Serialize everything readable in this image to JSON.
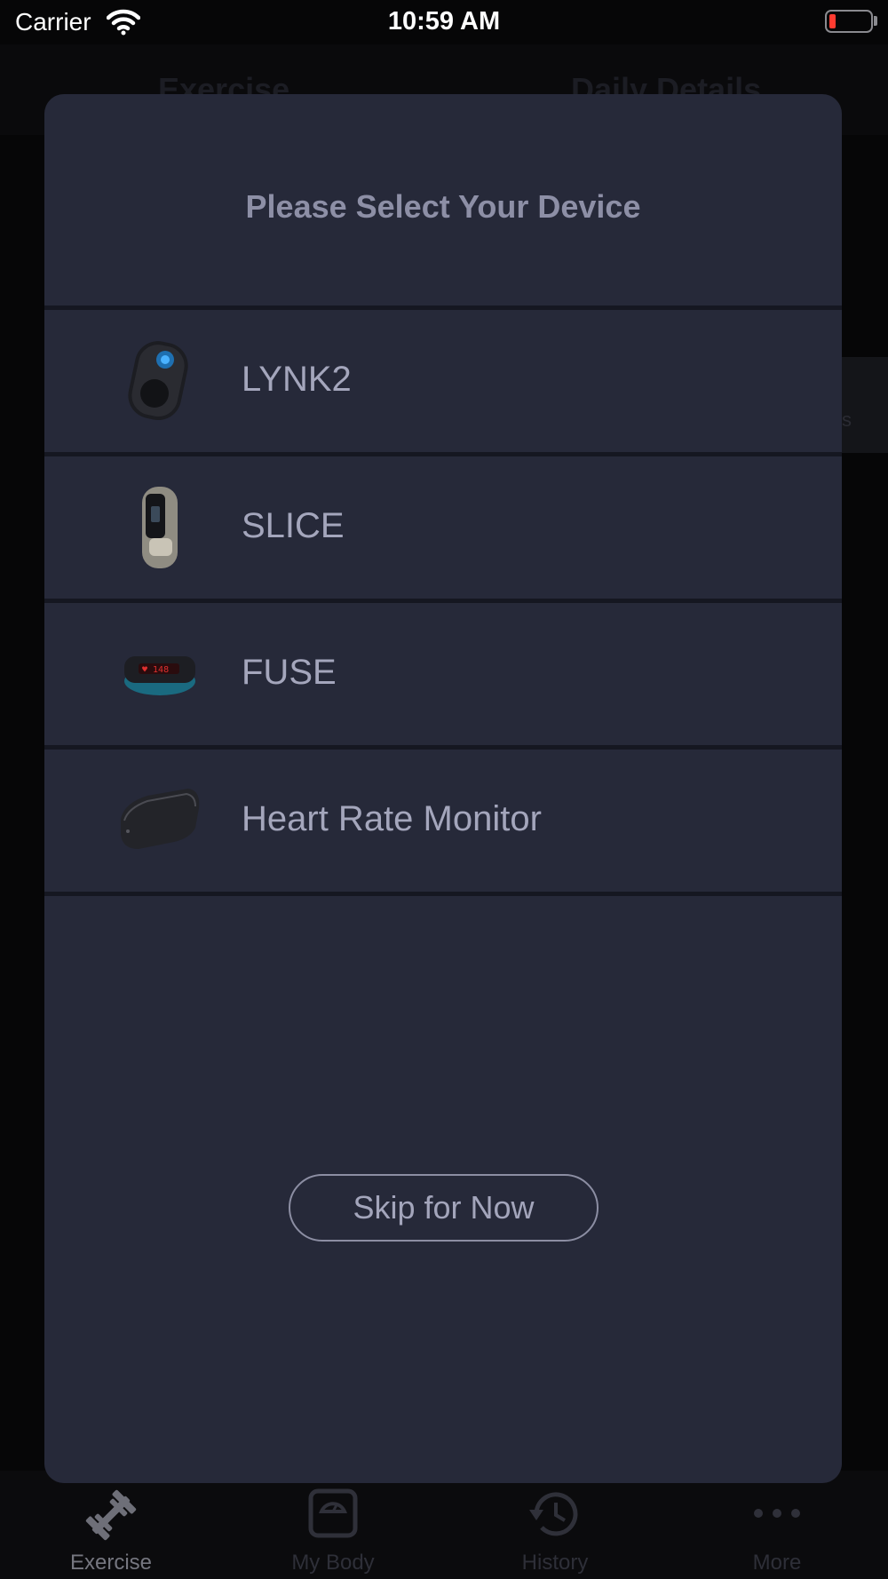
{
  "status_bar": {
    "carrier": "Carrier",
    "time": "10:59 AM"
  },
  "background": {
    "header_tabs": [
      "Exercise",
      "Daily Details"
    ],
    "card_fragment": "s"
  },
  "tab_bar": {
    "items": [
      {
        "label": "Exercise",
        "icon": "dumbbell-icon",
        "active": true
      },
      {
        "label": "My Body",
        "icon": "scale-icon",
        "active": false
      },
      {
        "label": "History",
        "icon": "history-icon",
        "active": false
      },
      {
        "label": "More",
        "icon": "more-dots-icon",
        "active": false
      }
    ]
  },
  "modal": {
    "title": "Please Select Your Device",
    "devices": [
      {
        "label": "LYNK2",
        "icon": "lynk2-device-icon"
      },
      {
        "label": "SLICE",
        "icon": "slice-device-icon"
      },
      {
        "label": "FUSE",
        "icon": "fuse-device-icon"
      },
      {
        "label": "Heart Rate Monitor",
        "icon": "heart-rate-monitor-icon"
      }
    ],
    "skip_label": "Skip for Now"
  },
  "colors": {
    "modal_bg": "#262939",
    "title_text": "#8d8fa6",
    "row_text": "#a4a6bc",
    "divider": "#151721",
    "battery_low": "#ff3b30"
  }
}
